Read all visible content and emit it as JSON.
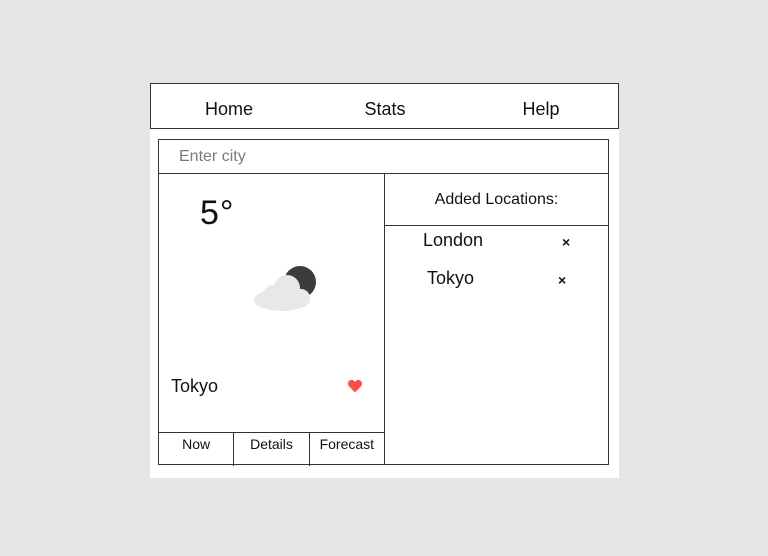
{
  "nav": {
    "items": [
      {
        "label": "Home"
      },
      {
        "label": "Stats"
      },
      {
        "label": "Help"
      }
    ]
  },
  "search": {
    "placeholder": "Enter city",
    "value": ""
  },
  "weather": {
    "temperature": "5°",
    "condition_icon": "partly-cloudy-icon",
    "city": "Tokyo",
    "favorite_icon": "heart-icon",
    "favorite_color": "#ff4d4d",
    "cloud_color": "#e8e8e8",
    "sun_color": "#3c3c3c",
    "tabs": [
      {
        "label": "Now"
      },
      {
        "label": "Details"
      },
      {
        "label": "Forecast"
      }
    ]
  },
  "locations": {
    "header": "Added Locations:",
    "items": [
      {
        "name": "London",
        "remove_icon": "close-icon",
        "remove_label": "×"
      },
      {
        "name": "Tokyo",
        "remove_icon": "close-icon",
        "remove_label": "×"
      }
    ]
  }
}
